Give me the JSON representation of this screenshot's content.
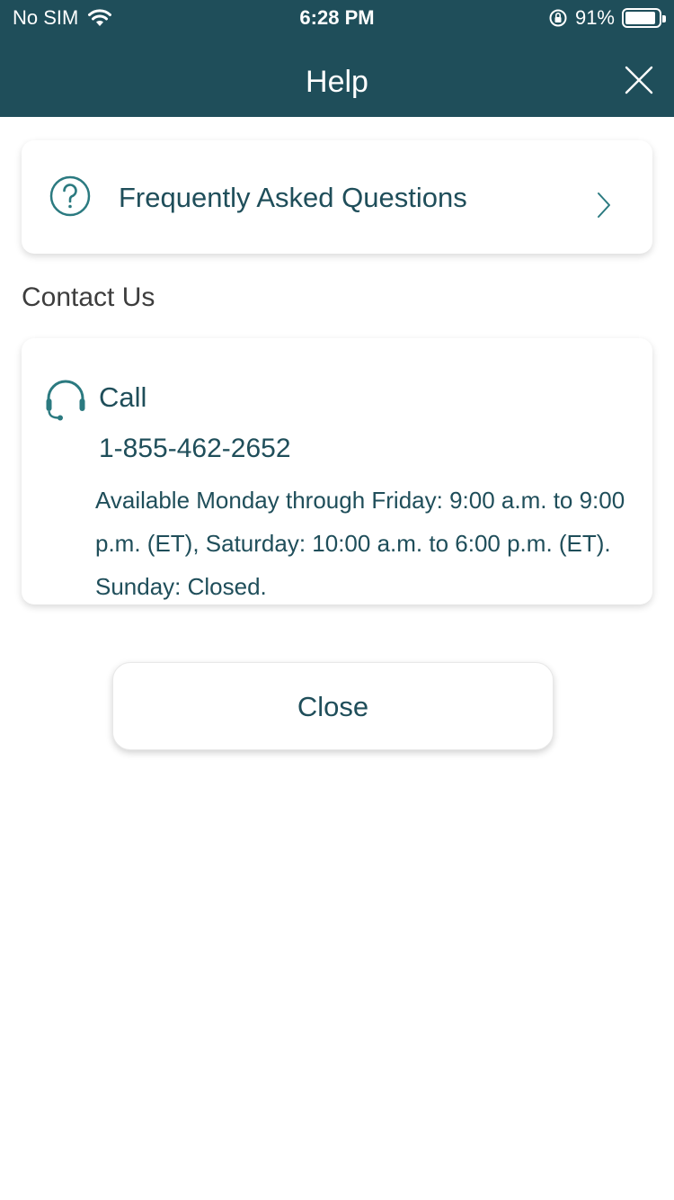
{
  "status_bar": {
    "carrier": "No SIM",
    "time": "6:28 PM",
    "battery_percent": "91%",
    "battery_level": 0.91,
    "icons": [
      "wifi-icon",
      "orientation-lock-icon",
      "battery-icon"
    ]
  },
  "header": {
    "title": "Help",
    "close_icon": "close-icon"
  },
  "faq": {
    "label": "Frequently Asked Questions",
    "icon": "question-circle-icon",
    "chevron": "chevron-right-icon"
  },
  "contact": {
    "section_title": "Contact Us",
    "call_label": "Call",
    "icon": "headset-icon",
    "phone": "1-855-462-2652",
    "hours": "Available Monday through Friday: 9:00 a.m. to 9:00 p.m. (ET), Saturday: 10:00 a.m. to 6:00 p.m. (ET). Sunday: Closed."
  },
  "footer": {
    "close_label": "Close"
  },
  "colors": {
    "header_bg": "#1f4e5a",
    "accent": "#2b7a80",
    "text": "#1f4e5a"
  }
}
